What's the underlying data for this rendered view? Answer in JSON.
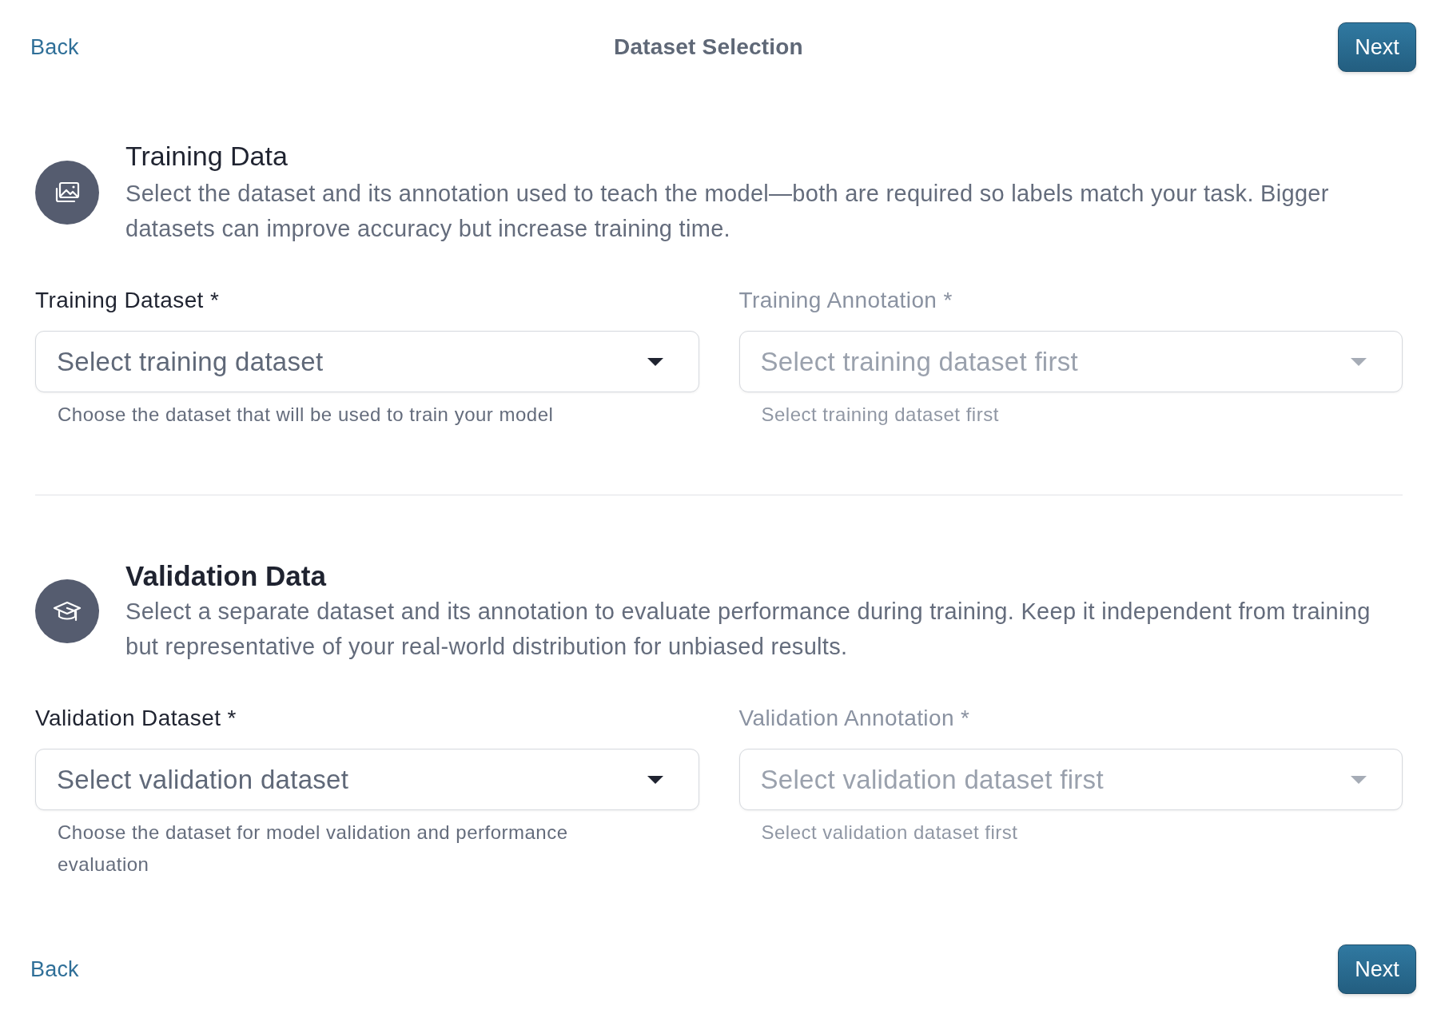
{
  "header": {
    "back": "Back",
    "title": "Dataset Selection",
    "next": "Next"
  },
  "sections": [
    {
      "title": "Training Data",
      "description": "Select the dataset and its annotation used to teach the model—both are required so labels match your task. Bigger datasets can improve accuracy but increase training time.",
      "fields": [
        {
          "label": "Training Dataset *",
          "placeholder": "Select training dataset",
          "helper": "Choose the dataset that will be used to train your model",
          "disabled": false
        },
        {
          "label": "Training Annotation *",
          "placeholder": "Select training dataset first",
          "helper": "Select training dataset first",
          "disabled": true
        }
      ]
    },
    {
      "title": "Validation Data",
      "description": "Select a separate dataset and its annotation to evaluate performance during training. Keep it independent from training but representative of your real-world distribution for unbiased results.",
      "fields": [
        {
          "label": "Validation Dataset *",
          "placeholder": "Select validation dataset",
          "helper": "Choose the dataset for model validation and performance evaluation",
          "disabled": false
        },
        {
          "label": "Validation Annotation *",
          "placeholder": "Select validation dataset first",
          "helper": "Select validation dataset first",
          "disabled": true
        }
      ]
    }
  ],
  "footer": {
    "back": "Back",
    "next": "Next"
  }
}
